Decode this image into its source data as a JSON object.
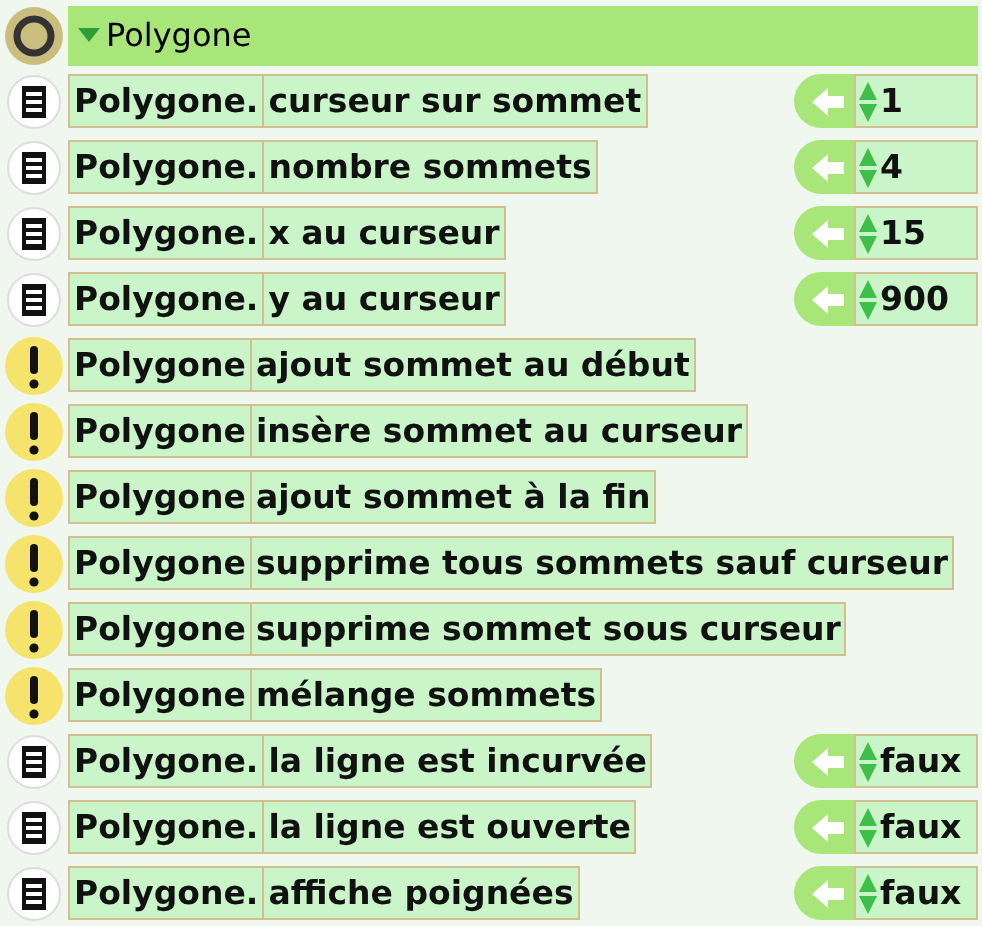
{
  "header": {
    "title": "Polygone",
    "expanded": true
  },
  "rows": [
    {
      "kind": "property",
      "object": "Polygone.",
      "label": "curseur sur sommet",
      "value": "1"
    },
    {
      "kind": "property",
      "object": "Polygone.",
      "label": "nombre sommets",
      "value": "4"
    },
    {
      "kind": "property",
      "object": "Polygone.",
      "label": "x au curseur",
      "value": "15"
    },
    {
      "kind": "property",
      "object": "Polygone.",
      "label": "y au curseur",
      "value": "900"
    },
    {
      "kind": "action",
      "object": "Polygone",
      "label": "ajout sommet au début"
    },
    {
      "kind": "action",
      "object": "Polygone",
      "label": "insère sommet au curseur"
    },
    {
      "kind": "action",
      "object": "Polygone",
      "label": "ajout sommet à la fin"
    },
    {
      "kind": "action",
      "object": "Polygone",
      "label": "supprime tous sommets sauf curseur"
    },
    {
      "kind": "action",
      "object": "Polygone",
      "label": "supprime sommet sous curseur"
    },
    {
      "kind": "action",
      "object": "Polygone",
      "label": "mélange sommets"
    },
    {
      "kind": "property",
      "object": "Polygone.",
      "label": "la ligne est incurvée",
      "value": "faux"
    },
    {
      "kind": "property",
      "object": "Polygone.",
      "label": "la ligne est ouverte",
      "value": "faux"
    },
    {
      "kind": "property",
      "object": "Polygone.",
      "label": "affiche poignées",
      "value": "faux"
    }
  ]
}
